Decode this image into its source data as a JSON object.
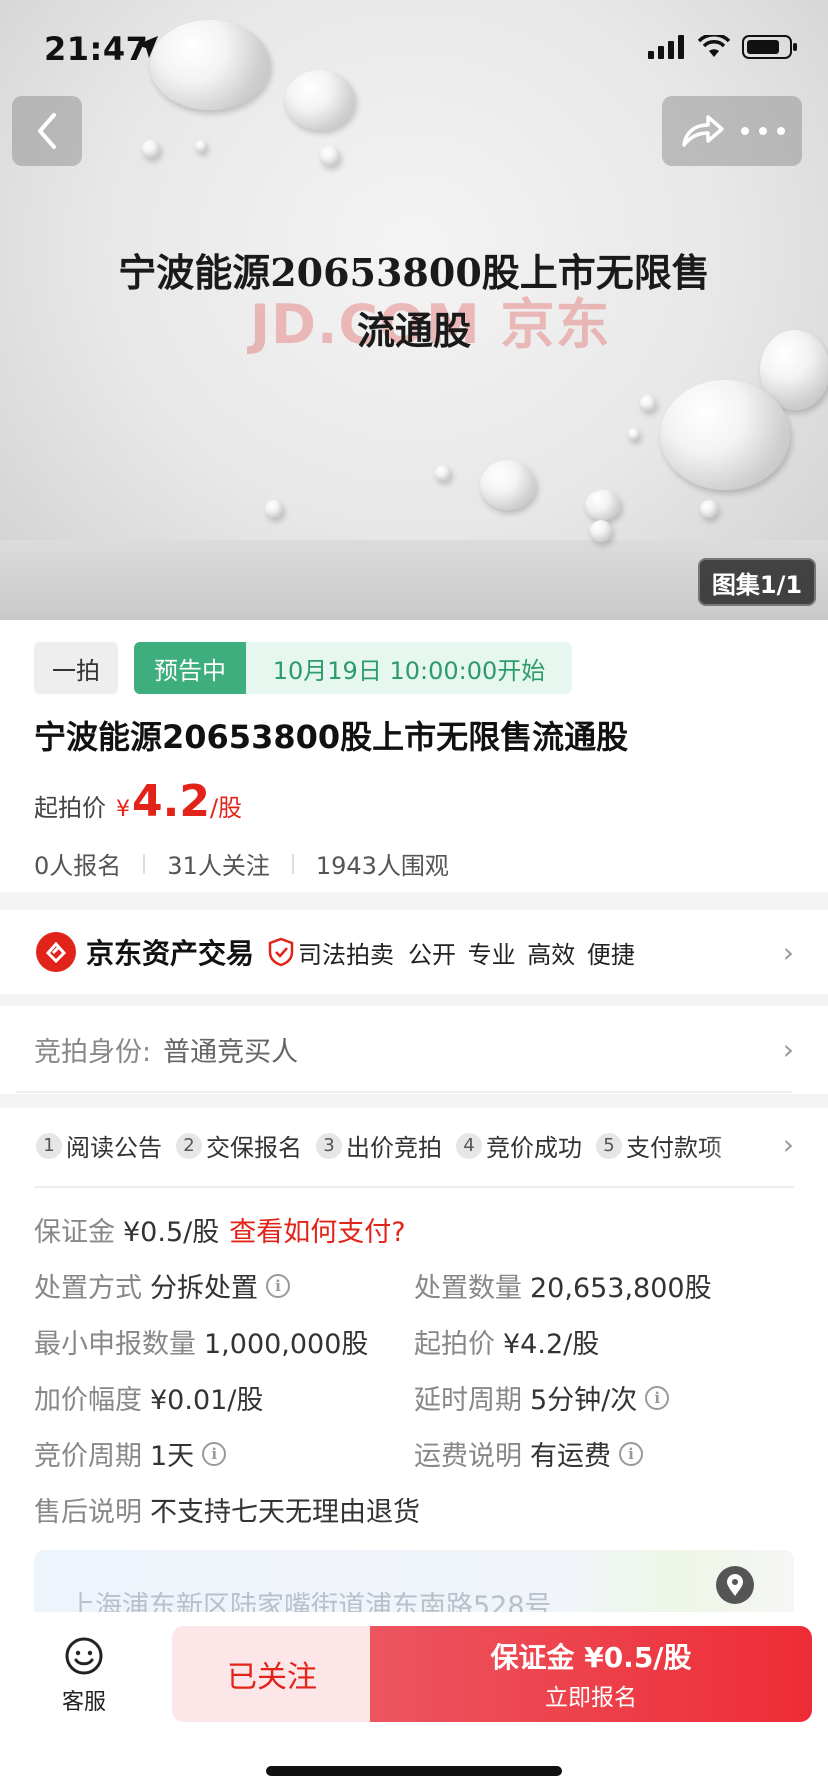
{
  "status_bar": {
    "time": "21:47"
  },
  "hero": {
    "title_line1": "宁波能源20653800股上市无限售",
    "title_line2": "流通股",
    "watermark": "JD.COM 京东",
    "gallery_badge": "图集1/1"
  },
  "auction": {
    "type_tag": "一拍",
    "status_tag": "预告中",
    "start_time": "10月19日 10:00:00开始",
    "title": "宁波能源20653800股上市无限售流通股",
    "price_label": "起拍价",
    "price_symbol": "¥",
    "price_value": "4.2",
    "price_unit": "/股",
    "stats": {
      "registered": "0人报名",
      "followers": "31人关注",
      "viewers": "1943人围观"
    }
  },
  "seller": {
    "name": "京东资产交易",
    "type": "司法拍卖",
    "slogan": "公开 专业 高效 便捷"
  },
  "identity": {
    "label": "竞拍身份:",
    "value": "普通竞买人"
  },
  "steps": [
    {
      "num": "1",
      "label": "阅读公告"
    },
    {
      "num": "2",
      "label": "交保报名"
    },
    {
      "num": "3",
      "label": "出价竞拍"
    },
    {
      "num": "4",
      "label": "竞价成功"
    },
    {
      "num": "5",
      "label": "支付款项"
    }
  ],
  "details": {
    "deposit_label": "保证金",
    "deposit_value": "¥0.5/股",
    "deposit_link": "查看如何支付?",
    "method_label": "处置方式",
    "method_value": "分拆处置",
    "quantity_label": "处置数量",
    "quantity_value": "20,653,800股",
    "min_label": "最小申报数量",
    "min_value": "1,000,000股",
    "start_label": "起拍价",
    "start_value": "¥4.2/股",
    "increment_label": "加价幅度",
    "increment_value": "¥0.01/股",
    "delay_label": "延时周期",
    "delay_value": "5分钟/次",
    "cycle_label": "竞价周期",
    "cycle_value": "1天",
    "shipping_label": "运费说明",
    "shipping_value": "有运费",
    "aftersale_label": "售后说明",
    "aftersale_value": "不支持七天无理由退货"
  },
  "address": "上海浦东新区陆家嘴街道浦东南路528号",
  "bottom_bar": {
    "service_label": "客服",
    "follow_label": "已关注",
    "signup_main": "保证金 ¥0.5/股",
    "signup_sub": "立即报名"
  },
  "colors": {
    "accent_red": "#e2231a",
    "status_green": "#3fae7f"
  }
}
